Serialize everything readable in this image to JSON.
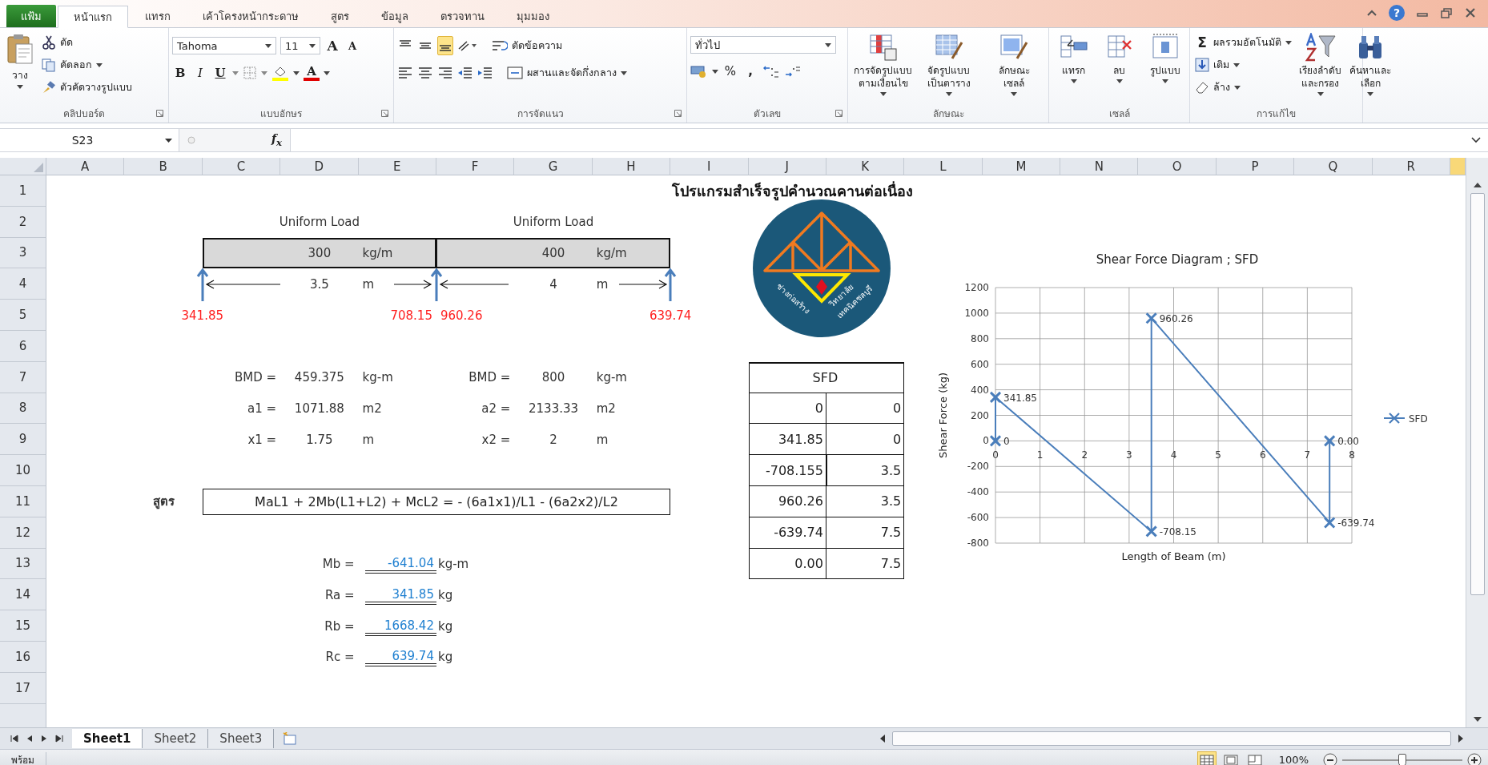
{
  "ribbon_tabs": [
    {
      "label": "แฟ้ม",
      "kind": "file",
      "selected": false
    },
    {
      "label": "หน้าแรก",
      "kind": "tab",
      "selected": true
    },
    {
      "label": "แทรก",
      "kind": "tab",
      "selected": false
    },
    {
      "label": "เค้าโครงหน้ากระดาษ",
      "kind": "tab",
      "selected": false
    },
    {
      "label": "สูตร",
      "kind": "tab",
      "selected": false
    },
    {
      "label": "ข้อมูล",
      "kind": "tab",
      "selected": false
    },
    {
      "label": "ตรวจทาน",
      "kind": "tab",
      "selected": false
    },
    {
      "label": "มุมมอง",
      "kind": "tab",
      "selected": false
    }
  ],
  "window_controls": {
    "help": "?"
  },
  "ribbon": [
    {
      "kind": "clipboard",
      "label": "คลิปบอร์ด",
      "paste": "วาง",
      "cut": "ตัด",
      "copy": "คัดลอก",
      "format_painter": "ตัวคัดวางรูปแบบ"
    },
    {
      "kind": "font",
      "label": "แบบอักษร",
      "font_name": "Tahoma",
      "font_size": "11",
      "grow": "A",
      "shrink": "A",
      "bold": "B",
      "italic": "I",
      "underline": "U",
      "font_color": "A"
    },
    {
      "kind": "alignment",
      "label": "การจัดแนว",
      "wrap_text": "ตัดข้อความ",
      "merge_center": "ผสานและจัดกึ่งกลาง",
      "vertical": [
        {
          "selected": false
        },
        {
          "selected": false
        },
        {
          "selected": true
        }
      ]
    },
    {
      "kind": "number",
      "label": "ตัวเลข",
      "format": "ทั่วไป",
      "percent": "%",
      "comma": ","
    },
    {
      "kind": "styles",
      "label": "ลักษณะ",
      "buttons": [
        {
          "kind": "conditional",
          "lines": [
            "การจัดรูปแบบ",
            "ตามเงื่อนไข"
          ]
        },
        {
          "kind": "table",
          "lines": [
            "จัดรูปแบบ",
            "เป็นตาราง"
          ]
        },
        {
          "kind": "cell_styles",
          "lines": [
            "ลักษณะ",
            "เซลล์"
          ]
        }
      ]
    },
    {
      "kind": "cells",
      "label": "เซลล์",
      "buttons": [
        {
          "kind": "insert",
          "lines": [
            "แทรก"
          ]
        },
        {
          "kind": "delete",
          "lines": [
            "ลบ"
          ]
        },
        {
          "kind": "format",
          "lines": [
            "รูปแบบ"
          ]
        }
      ]
    },
    {
      "kind": "editing",
      "label": "การแก้ไข",
      "sigma": "Σ",
      "autosum": "ผลรวมอัตโนมัติ",
      "fill": "เติม",
      "clear": "ล้าง",
      "buttons": [
        {
          "kind": "sort",
          "lines": [
            "เรียงลำดับ",
            "และกรอง"
          ]
        },
        {
          "kind": "find",
          "lines": [
            "ค้นหาและ",
            "เลือก"
          ]
        }
      ]
    }
  ],
  "formula_bar": {
    "name_box": "S23",
    "function_label": "f$_{x}$"
  },
  "column_headers": [
    "A",
    "B",
    "C",
    "D",
    "E",
    "F",
    "G",
    "H",
    "I",
    "J",
    "K",
    "L",
    "M",
    "N",
    "O",
    "P",
    "Q",
    "R"
  ],
  "row_headers": [
    "1",
    "2",
    "3",
    "4",
    "5",
    "6",
    "7",
    "8",
    "9",
    "10",
    "11",
    "12",
    "13",
    "14",
    "15",
    "16",
    "17"
  ],
  "sheet": {
    "title": "โปรแกรมสำเร็จรูปคำนวณคานต่อเนื่อง",
    "logo_texts": [
      "ช่างก่อสร้าง",
      "วิทยาลัย",
      "เทคนิคชลบุรี"
    ],
    "beam_spans": [
      {
        "load_label": "Uniform Load",
        "load": "300",
        "load_unit": "kg/m",
        "length": "3.5",
        "length_unit": "m"
      },
      {
        "load_label": "Uniform Load",
        "load": "400",
        "load_unit": "kg/m",
        "length": "4",
        "length_unit": "m"
      }
    ],
    "reactions": [
      "341.85",
      "708.15",
      "960.26",
      "639.74"
    ],
    "calculations": [
      [
        {
          "label": "BMD =",
          "value": "459.375",
          "unit": "kg-m"
        },
        {
          "label": "a1 =",
          "value": "1071.88",
          "unit": "m2"
        },
        {
          "label": "x1 =",
          "value": "1.75",
          "unit": "m"
        }
      ],
      [
        {
          "label": "BMD =",
          "value": "800",
          "unit": "kg-m"
        },
        {
          "label": "a2 =",
          "value": "2133.33",
          "unit": "m2"
        },
        {
          "label": "x2 =",
          "value": "2",
          "unit": "m"
        }
      ]
    ],
    "formula": {
      "label": "สูตร",
      "text": "MaL1 + 2Mb(L1+L2) + McL2 = - (6a1x1)/L1 - (6a2x2)/L2"
    },
    "results": [
      {
        "label": "Mb =",
        "value": "-641.04",
        "unit": "kg-m"
      },
      {
        "label": "Ra =",
        "value": "341.85",
        "unit": "kg"
      },
      {
        "label": "Rb =",
        "value": "1668.42",
        "unit": "kg"
      },
      {
        "label": "Rc =",
        "value": "639.74",
        "unit": "kg"
      }
    ],
    "sfd_table": {
      "title": "SFD",
      "rows": [
        [
          "0",
          "0"
        ],
        [
          "341.85",
          "0"
        ],
        [
          "-708.155",
          "3.5"
        ],
        [
          "960.26",
          "3.5"
        ],
        [
          "-639.74",
          "7.5"
        ],
        [
          "0.00",
          "7.5"
        ]
      ]
    },
    "chart": {
      "chart_data": {
        "type": "line",
        "grid": true,
        "title": "Shear Force Diagram ; SFD",
        "xlabel": "Length of Beam (m)",
        "ylabel": "Shear Force (kg)",
        "x": [
          0,
          0,
          3.5,
          3.5,
          7.5,
          7.5
        ],
        "series": [
          {
            "name": "SFD",
            "color": "#4a7ebb",
            "marker": "x",
            "values": [
              0,
              341.85,
              -708.155,
              960.26,
              -639.74,
              0
            ]
          }
        ],
        "xlim": [
          0,
          8
        ],
        "ylim": [
          -800,
          1200
        ],
        "xticks": [
          0,
          1,
          2,
          3,
          4,
          5,
          6,
          7,
          8
        ],
        "yticks": [
          -800,
          -600,
          -400,
          -200,
          0,
          200,
          400,
          600,
          800,
          1000,
          1200
        ],
        "value_labels": [
          "0",
          "341.85",
          "-708.15",
          "960.26",
          "-639.74",
          "0.00"
        ]
      }
    }
  },
  "sheet_tabs": [
    {
      "label": "Sheet1",
      "selected": true
    },
    {
      "label": "Sheet2",
      "selected": false
    },
    {
      "label": "Sheet3",
      "selected": false
    }
  ],
  "status_bar": {
    "status": "พร้อม",
    "views": [
      {
        "kind": "normal",
        "selected": true
      },
      {
        "kind": "layout",
        "selected": false
      },
      {
        "kind": "page_break",
        "selected": false
      }
    ],
    "zoom": "100%",
    "level": 0.5
  }
}
